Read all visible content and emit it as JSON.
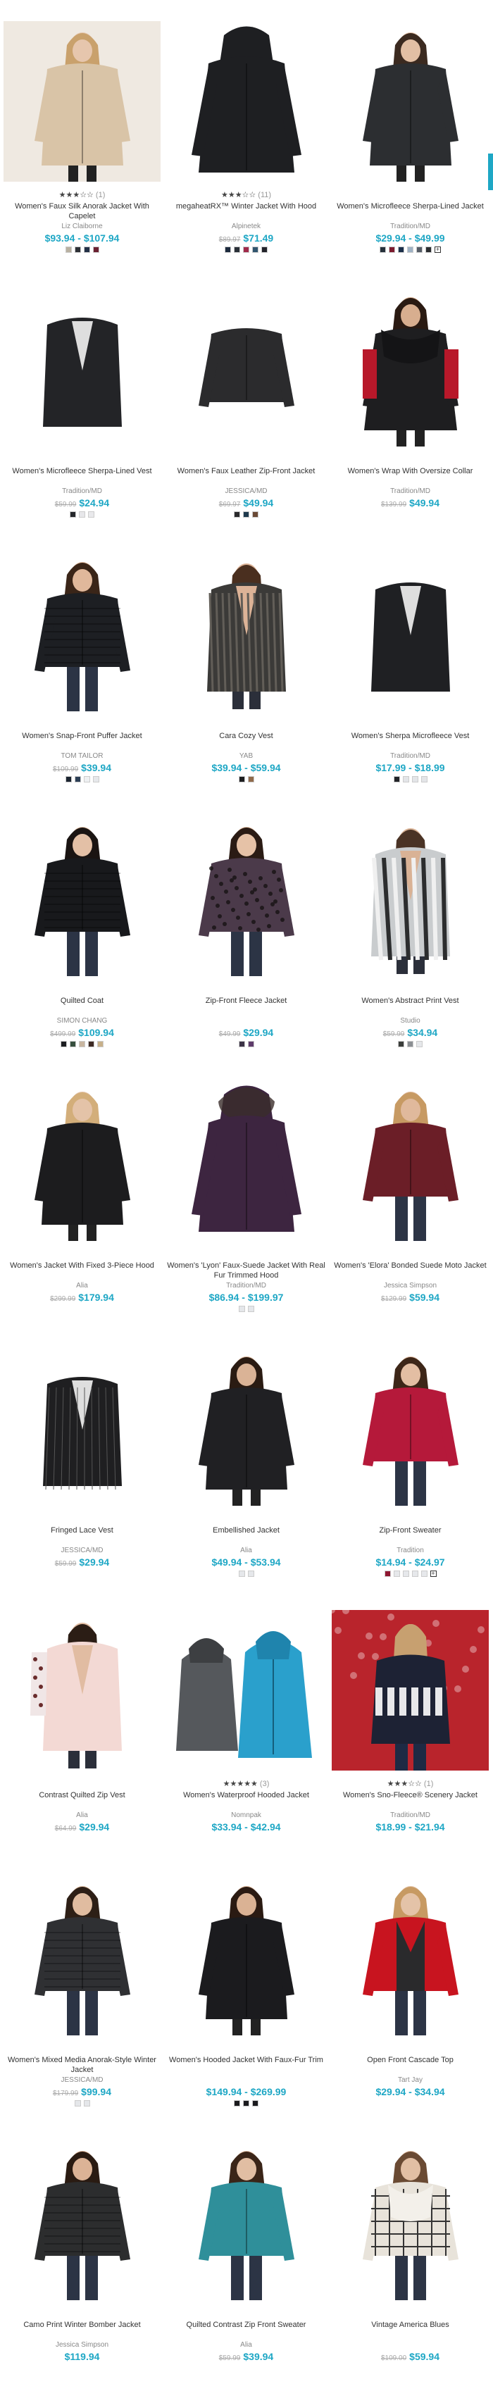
{
  "colors": {
    "price": "#1ea7c5",
    "strike": "#aaaaaa",
    "side_tab": "#1ea7c5"
  },
  "products": [
    {
      "name": "Women's Faux Silk Anorak Jacket With Capelet",
      "brand": "Liz Claiborne",
      "rating": "★★★☆☆",
      "rating_count": "(1)",
      "was": "",
      "price": "$93.94 - $107.94",
      "swatches": [
        "#b9b1a1",
        "#2d3036",
        "#233047",
        "#6a2030"
      ],
      "more": false,
      "img": {
        "bg": "#efe9e1",
        "coat": "#d9c4a7",
        "skin": "#e6c6ad",
        "hair": "#c9a16c",
        "shape": "coat"
      }
    },
    {
      "name": "megaheatRX™ Winter Jacket With Hood",
      "brand": "Alpinetek",
      "rating": "★★★☆☆",
      "rating_count": "(11)",
      "was": "$89.97",
      "price": "$71.49",
      "swatches": [
        "#1c2a3d",
        "#2a3038",
        "#a02a4a",
        "#31556e",
        "#22232a"
      ],
      "more": false,
      "img": {
        "bg": "#ffffff",
        "coat": "#1e1f22",
        "skin": "",
        "hair": "",
        "shape": "hood"
      }
    },
    {
      "name": "Women's Microfleece Sherpa-Lined Jacket",
      "brand": "Tradition/MD",
      "rating": "",
      "rating_count": "",
      "was": "",
      "price": "$29.94 - $49.99",
      "swatches": [
        "#25303b",
        "#7c1b2e",
        "#1b2f4a",
        "#9fb2c4",
        "#555c66",
        "#2b2d30"
      ],
      "more": true,
      "img": {
        "bg": "#ffffff",
        "coat": "#2c2e31",
        "skin": "#e2bfa4",
        "hair": "#3b2a20",
        "shape": "coat"
      }
    },
    {
      "name": "Women's Microfleece Sherpa-Lined Vest",
      "brand": "Tradition/MD",
      "rating": "",
      "rating_count": "",
      "was": "$59.99",
      "price": "$24.94",
      "swatches": [
        "#24272b",
        "#e7e7ea",
        "#e9e9ec"
      ],
      "more": false,
      "img": {
        "bg": "#ffffff",
        "coat": "#232427",
        "skin": "",
        "hair": "",
        "shape": "vest"
      }
    },
    {
      "name": "Women's Faux Leather Zip-Front Jacket",
      "brand": "JESSICA/MD",
      "rating": "",
      "rating_count": "",
      "was": "$69.97",
      "price": "$49.94",
      "swatches": [
        "#2a2a2c",
        "#1e3a4d",
        "#6a4a36"
      ],
      "more": false,
      "img": {
        "bg": "#ffffff",
        "coat": "#2b2b2d",
        "skin": "",
        "hair": "",
        "shape": "jacket"
      }
    },
    {
      "name": "Women's Wrap With Oversize Collar",
      "brand": "Tradition/MD",
      "rating": "",
      "rating_count": "",
      "was": "$139.99",
      "price": "$49.94",
      "swatches": [],
      "more": false,
      "img": {
        "bg": "#ffffff",
        "coat": "#1e1e20",
        "skin": "#d8ae8f",
        "hair": "#2a1a12",
        "shape": "wrap"
      }
    },
    {
      "name": "Women's Snap-Front Puffer Jacket",
      "brand": "TOM TAILOR",
      "rating": "",
      "rating_count": "",
      "was": "$109.99",
      "price": "$39.94",
      "swatches": [
        "#1c2530",
        "#2c3f55",
        "#eef0f2",
        "#e6e8eb"
      ],
      "more": false,
      "img": {
        "bg": "#ffffff",
        "coat": "#1d1f23",
        "skin": "#e0b89b",
        "hair": "#3a2518",
        "shape": "puffer"
      }
    },
    {
      "name": "Cara Cozy Vest",
      "brand": "YAB",
      "rating": "",
      "rating_count": "",
      "was": "",
      "price": "$39.94 - $59.94",
      "swatches": [
        "#1e1e20",
        "#8f6a4b"
      ],
      "more": false,
      "img": {
        "bg": "#ffffff",
        "coat": "#3b3a38",
        "skin": "#dcb397",
        "hair": "#4a2f1f",
        "shape": "furvest"
      }
    },
    {
      "name": "Women's Sherpa Microfleece Vest",
      "brand": "Tradition/MD",
      "rating": "",
      "rating_count": "",
      "was": "",
      "price": "$17.99 - $18.99",
      "swatches": [
        "#222428",
        "#e3e5e8",
        "#e3e5e8",
        "#e3e5e8"
      ],
      "more": false,
      "img": {
        "bg": "#ffffff",
        "coat": "#1f2023",
        "skin": "",
        "hair": "",
        "shape": "vest"
      }
    },
    {
      "name": "Quilted Coat",
      "brand": "SIMON CHANG",
      "rating": "",
      "rating_count": "",
      "was": "$499.99",
      "price": "$109.94",
      "swatches": [
        "#1c1d20",
        "#364f3e",
        "#c8b6a0",
        "#3d2a24",
        "#c7b08a"
      ],
      "more": false,
      "img": {
        "bg": "#ffffff",
        "coat": "#18191c",
        "skin": "#e3c0a6",
        "hair": "#1a1412",
        "shape": "puffer"
      }
    },
    {
      "name": "Zip-Front Fleece Jacket",
      "brand": "",
      "rating": "",
      "rating_count": "",
      "was": "$49.99",
      "price": "$29.94",
      "swatches": [
        "#3b3346",
        "#5e3b6b"
      ],
      "more": false,
      "img": {
        "bg": "#ffffff",
        "coat": "#4b3a4a",
        "skin": "#e6c2a7",
        "hair": "#2a1b14",
        "shape": "leopard"
      }
    },
    {
      "name": "Women's Abstract Print Vest",
      "brand": "Studio",
      "rating": "",
      "rating_count": "",
      "was": "$59.99",
      "price": "$34.94",
      "swatches": [
        "#3a3d3a",
        "#8b8f93",
        "#e5e7ea"
      ],
      "more": false,
      "img": {
        "bg": "#ffffff",
        "coat": "#c9ccce",
        "skin": "#d9b295",
        "hair": "#4a3325",
        "shape": "printvest"
      }
    },
    {
      "name": "Women's Jacket With Fixed 3-Piece Hood",
      "brand": "Alia",
      "rating": "",
      "rating_count": "",
      "was": "$299.99",
      "price": "$179.94",
      "swatches": [],
      "more": false,
      "img": {
        "bg": "#ffffff",
        "coat": "#1c1c1e",
        "skin": "#e4c3a8",
        "hair": "#d3ae7a",
        "shape": "coat"
      }
    },
    {
      "name": "Women's 'Lyon' Faux-Suede Jacket With Real Fur Trimmed Hood",
      "brand": "Tradition/MD",
      "rating": "",
      "rating_count": "",
      "was": "",
      "price": "$86.94 - $199.97",
      "swatches": [
        "#e5e7ea",
        "#e5e7ea"
      ],
      "more": false,
      "img": {
        "bg": "#ffffff",
        "coat": "#3d2540",
        "skin": "",
        "hair": "",
        "shape": "hood"
      }
    },
    {
      "name": "Women's 'Elora' Bonded Suede Moto Jacket",
      "brand": "Jessica Simpson",
      "rating": "",
      "rating_count": "",
      "was": "$129.99",
      "price": "$59.94",
      "swatches": [],
      "more": false,
      "img": {
        "bg": "#ffffff",
        "coat": "#6b1e27",
        "skin": "#e0b99c",
        "hair": "#c79a63",
        "shape": "jacket"
      }
    },
    {
      "name": "Fringed Lace Vest",
      "brand": "JESSICA/MD",
      "rating": "",
      "rating_count": "",
      "was": "$59.99",
      "price": "$29.94",
      "swatches": [],
      "more": false,
      "img": {
        "bg": "#ffffff",
        "coat": "#1f1f21",
        "skin": "",
        "hair": "",
        "shape": "lace"
      }
    },
    {
      "name": "Embellished Jacket",
      "brand": "Alia",
      "rating": "",
      "rating_count": "",
      "was": "",
      "price": "$49.94 - $53.94",
      "swatches": [
        "#e5e7ea",
        "#e5e7ea"
      ],
      "more": false,
      "img": {
        "bg": "#ffffff",
        "coat": "#202023",
        "skin": "#dab396",
        "hair": "#2a1b12",
        "shape": "coat"
      }
    },
    {
      "name": "Zip-Front Sweater",
      "brand": "Tradition",
      "rating": "",
      "rating_count": "",
      "was": "",
      "price": "$14.94 - $24.97",
      "swatches": [
        "#8e1630",
        "#e6e8eb",
        "#e6e8eb",
        "#e6e8eb",
        "#e6e8eb"
      ],
      "more": true,
      "img": {
        "bg": "#ffffff",
        "coat": "#b5193a",
        "skin": "#e3bea3",
        "hair": "#3d2618",
        "shape": "jacket"
      }
    },
    {
      "name": "Contrast Quilted Zip Vest",
      "brand": "Alia",
      "rating": "",
      "rating_count": "",
      "was": "$64.99",
      "price": "$29.94",
      "swatches": [],
      "more": false,
      "img": {
        "bg": "#ffffff",
        "coat": "#e9c9c4",
        "skin": "#e1bca2",
        "hair": "#2b1d15",
        "shape": "pinkvest"
      }
    },
    {
      "name": "Women's Waterproof Hooded Jacket",
      "brand": "Nomnpak",
      "rating": "★★★★★",
      "rating_count": "(3)",
      "was": "",
      "price": "$33.94 - $42.94",
      "swatches": [],
      "more": false,
      "img": {
        "bg": "#ffffff",
        "coat": "#2aa0cc",
        "skin": "",
        "hair": "",
        "shape": "twojackets"
      }
    },
    {
      "name": "Women's Sno-Fleece® Scenery Jacket",
      "brand": "Tradition/MD",
      "rating": "★★★☆☆",
      "rating_count": "(1)",
      "was": "",
      "price": "$18.99 - $21.94",
      "swatches": [],
      "more": false,
      "img": {
        "bg": "#b9242c",
        "coat": "#1d2234",
        "skin": "#e3c0a6",
        "hair": "#c7a070",
        "shape": "scenery"
      }
    },
    {
      "name": "Women's Mixed Media Anorak-Style Winter Jacket",
      "brand": "JESSICA/MD",
      "rating": "",
      "rating_count": "",
      "was": "$179.99",
      "price": "$99.94",
      "swatches": [
        "#e5e7ea",
        "#e5e7ea"
      ],
      "more": false,
      "img": {
        "bg": "#ffffff",
        "coat": "#2f3033",
        "skin": "#e0bca0",
        "hair": "#2d1f16",
        "shape": "puffer"
      }
    },
    {
      "name": "Women's Hooded Jacket With Faux-Fur Trim",
      "brand": "",
      "rating": "",
      "rating_count": "",
      "was": "",
      "price": "$149.94 - $269.99",
      "swatches": [
        "#1b1b1e",
        "#1b1b1e",
        "#1b1b1e"
      ],
      "more": false,
      "img": {
        "bg": "#ffffff",
        "coat": "#1b1b1e",
        "skin": "#dab294",
        "hair": "#2a1a12",
        "shape": "coat"
      }
    },
    {
      "name": "Open Front Cascade Top",
      "brand": "Tart Jay",
      "rating": "",
      "rating_count": "",
      "was": "",
      "price": "$29.94 - $34.94",
      "swatches": [],
      "more": false,
      "img": {
        "bg": "#ffffff",
        "coat": "#c8141f",
        "skin": "#e4c3a8",
        "hair": "#c79a63",
        "shape": "cascade"
      }
    },
    {
      "name": "Camo Print Winter Bomber Jacket",
      "brand": "Jessica Simpson",
      "rating": "",
      "rating_count": "",
      "was": "",
      "price": "$119.94",
      "swatches": [],
      "more": false,
      "img": {
        "bg": "#ffffff",
        "coat": "#2c2d2e",
        "skin": "#dcb396",
        "hair": "#2a1b12",
        "shape": "puffer"
      }
    },
    {
      "name": "Quilted Contrast Zip Front Sweater",
      "brand": "Alia",
      "rating": "",
      "rating_count": "",
      "was": "$59.99",
      "price": "$39.94",
      "swatches": [],
      "more": false,
      "img": {
        "bg": "#ffffff",
        "coat": "#2f8f9a",
        "skin": "#e1bea3",
        "hair": "#3a2518",
        "shape": "jacket"
      }
    },
    {
      "name": "Vintage America Blues",
      "brand": "",
      "rating": "",
      "rating_count": "",
      "was": "$109.00",
      "price": "$59.94",
      "swatches": [],
      "more": false,
      "img": {
        "bg": "#ffffff",
        "coat": "#e8e3da",
        "skin": "#e2bfa4",
        "hair": "#6a4a33",
        "shape": "plaid"
      }
    }
  ]
}
